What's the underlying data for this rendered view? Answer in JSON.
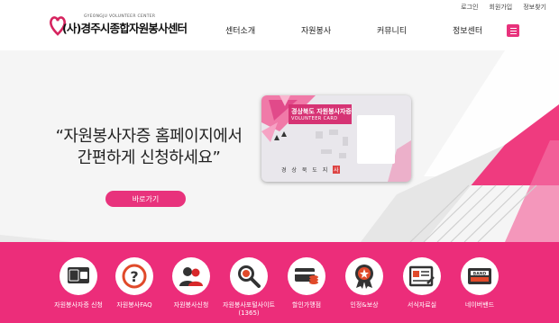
{
  "colors": {
    "accent": "#ec2d7a",
    "brand_pink": "#e8327c"
  },
  "top_links": [
    "로그인",
    "회원가입",
    "정보찾기"
  ],
  "logo": {
    "main": "(사)경주시종합자원봉사센터",
    "sub": "GYEONGJU VOLUNTEER CENTER"
  },
  "main_nav": [
    "센터소개",
    "자원봉사",
    "커뮤니티",
    "정보센터"
  ],
  "hero": {
    "line1": "“자원봉사자증 홈페이지에서",
    "line2": "간편하게 신청하세요”",
    "button": "바로가기",
    "card_title": "경상북도 자원봉사자증",
    "card_sub": "VOLUNTEER CARD",
    "card_footer": "경 상 북 도 지",
    "card_seal": "사"
  },
  "services": [
    {
      "label": "자원봉사자증 신청",
      "icon": "card-icon"
    },
    {
      "label": "자원봉사FAQ",
      "icon": "question-icon"
    },
    {
      "label": "자원봉사신청",
      "icon": "people-icon"
    },
    {
      "label": "자원봉사포털사이트",
      "label2": "(1365)",
      "icon": "magnifier-icon"
    },
    {
      "label": "할인가맹점",
      "icon": "coins-card-icon"
    },
    {
      "label": "인정&보상",
      "icon": "medal-icon"
    },
    {
      "label": "서식자료실",
      "icon": "document-icon"
    },
    {
      "label": "네이버밴드",
      "icon": "band-icon"
    }
  ]
}
